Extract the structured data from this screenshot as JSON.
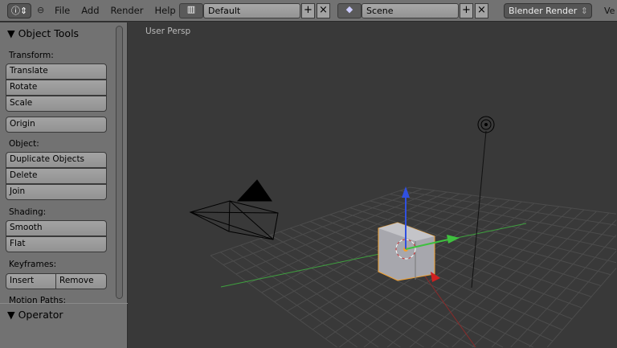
{
  "header": {
    "menus": [
      "File",
      "Add",
      "Render",
      "Help"
    ],
    "layout": "Default",
    "scene": "Scene",
    "engine": "Blender Render",
    "cut": "Ve"
  },
  "tools": {
    "title": "Object Tools",
    "transform_label": "Transform:",
    "translate": "Translate",
    "rotate": "Rotate",
    "scale": "Scale",
    "origin": "Origin",
    "object_label": "Object:",
    "duplicate": "Duplicate Objects",
    "delete": "Delete",
    "join": "Join",
    "shading_label": "Shading:",
    "smooth": "Smooth",
    "flat": "Flat",
    "keyframes_label": "Keyframes:",
    "insert": "Insert",
    "remove": "Remove",
    "motion_label": "Motion Paths:",
    "operator": "Operator"
  },
  "viewport": {
    "label": "User Persp"
  },
  "colors": {
    "x_axis": "#a23030",
    "y_axis": "#3fa03f",
    "selection": "#f0a030"
  }
}
